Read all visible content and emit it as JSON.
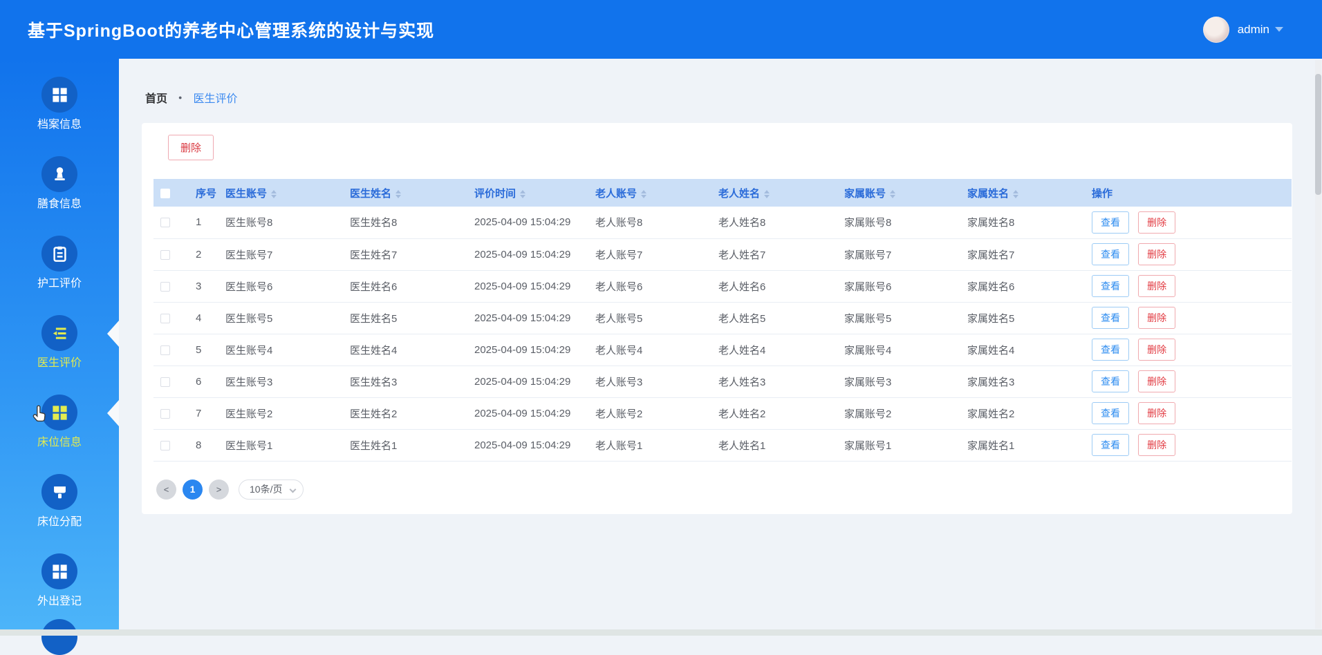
{
  "app": {
    "title": "基于SpringBoot的养老中心管理系统的设计与实现",
    "user": {
      "name": "admin"
    }
  },
  "sidebar": {
    "items": [
      {
        "label": "档案信息",
        "icon": "grid-icon",
        "state": "normal"
      },
      {
        "label": "膳食信息",
        "icon": "person-icon",
        "state": "normal"
      },
      {
        "label": "护工评价",
        "icon": "clipboard-icon",
        "state": "normal"
      },
      {
        "label": "医生评价",
        "icon": "list-arrow-icon",
        "state": "active"
      },
      {
        "label": "床位信息",
        "icon": "grid-icon",
        "state": "hover"
      },
      {
        "label": "床位分配",
        "icon": "brush-icon",
        "state": "normal"
      },
      {
        "label": "外出登记",
        "icon": "grid-icon",
        "state": "normal"
      }
    ]
  },
  "breadcrumb": {
    "home": "首页",
    "separator": "●",
    "current": "医生评价"
  },
  "toolbar": {
    "delete_label": "删除"
  },
  "table": {
    "columns": [
      {
        "label": "序号",
        "sortable": false
      },
      {
        "label": "医生账号",
        "sortable": true
      },
      {
        "label": "医生姓名",
        "sortable": true
      },
      {
        "label": "评价时间",
        "sortable": true
      },
      {
        "label": "老人账号",
        "sortable": true
      },
      {
        "label": "老人姓名",
        "sortable": true
      },
      {
        "label": "家属账号",
        "sortable": true
      },
      {
        "label": "家属姓名",
        "sortable": true
      },
      {
        "label": "操作",
        "sortable": false
      }
    ],
    "rows": [
      {
        "index": "1",
        "doctor_account": "医生账号8",
        "doctor_name": "医生姓名8",
        "time": "2025-04-09 15:04:29",
        "elder_account": "老人账号8",
        "elder_name": "老人姓名8",
        "family_account": "家属账号8",
        "family_name": "家属姓名8"
      },
      {
        "index": "2",
        "doctor_account": "医生账号7",
        "doctor_name": "医生姓名7",
        "time": "2025-04-09 15:04:29",
        "elder_account": "老人账号7",
        "elder_name": "老人姓名7",
        "family_account": "家属账号7",
        "family_name": "家属姓名7"
      },
      {
        "index": "3",
        "doctor_account": "医生账号6",
        "doctor_name": "医生姓名6",
        "time": "2025-04-09 15:04:29",
        "elder_account": "老人账号6",
        "elder_name": "老人姓名6",
        "family_account": "家属账号6",
        "family_name": "家属姓名6"
      },
      {
        "index": "4",
        "doctor_account": "医生账号5",
        "doctor_name": "医生姓名5",
        "time": "2025-04-09 15:04:29",
        "elder_account": "老人账号5",
        "elder_name": "老人姓名5",
        "family_account": "家属账号5",
        "family_name": "家属姓名5"
      },
      {
        "index": "5",
        "doctor_account": "医生账号4",
        "doctor_name": "医生姓名4",
        "time": "2025-04-09 15:04:29",
        "elder_account": "老人账号4",
        "elder_name": "老人姓名4",
        "family_account": "家属账号4",
        "family_name": "家属姓名4"
      },
      {
        "index": "6",
        "doctor_account": "医生账号3",
        "doctor_name": "医生姓名3",
        "time": "2025-04-09 15:04:29",
        "elder_account": "老人账号3",
        "elder_name": "老人姓名3",
        "family_account": "家属账号3",
        "family_name": "家属姓名3"
      },
      {
        "index": "7",
        "doctor_account": "医生账号2",
        "doctor_name": "医生姓名2",
        "time": "2025-04-09 15:04:29",
        "elder_account": "老人账号2",
        "elder_name": "老人姓名2",
        "family_account": "家属账号2",
        "family_name": "家属姓名2"
      },
      {
        "index": "8",
        "doctor_account": "医生账号1",
        "doctor_name": "医生姓名1",
        "time": "2025-04-09 15:04:29",
        "elder_account": "老人账号1",
        "elder_name": "老人姓名1",
        "family_account": "家属账号1",
        "family_name": "家属姓名1"
      }
    ],
    "row_actions": {
      "view": "查看",
      "delete": "删除"
    }
  },
  "pagination": {
    "prev": "<",
    "current_page": "1",
    "next": ">",
    "page_size": "10条/页"
  },
  "colors": {
    "header_bg": "#1173EC",
    "sidebar_bottom": "#4DB5F9",
    "icon_circle": "#1261C6",
    "active_item": "#E3EB4F",
    "table_header_bg": "#CBDFF7",
    "table_header_text": "#2A6BD9",
    "link_blue": "#3C8AF0",
    "danger_red": "#D9363E",
    "primary_blue": "#2B87F0",
    "page_bg": "#EFF3F8"
  }
}
